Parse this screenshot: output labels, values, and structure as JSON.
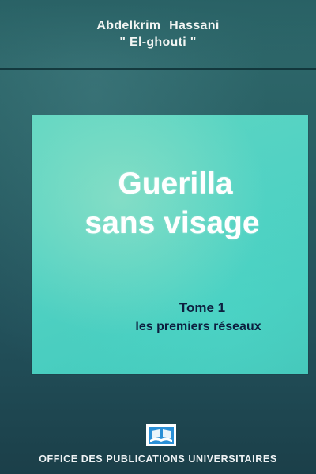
{
  "cover": {
    "author": {
      "first_name": "Abdelkrim",
      "last_name": "Hassani",
      "alias": "\" El-ghouti \""
    },
    "title_line1": "Guerilla",
    "title_line2": "sans visage",
    "volume_label": "Tome 1",
    "volume_subtitle": "les premiers réseaux",
    "publisher": "OFFICE DES PUBLICATIONS UNIVERSITAIRES",
    "publisher_logo_icon": "open-book-logo-icon"
  },
  "colors": {
    "background": "#285e63",
    "panel": "#52d2c3",
    "title": "#ffffff",
    "volume_text": "#0d1f3f",
    "logo_blue": "#2a8fd6"
  }
}
